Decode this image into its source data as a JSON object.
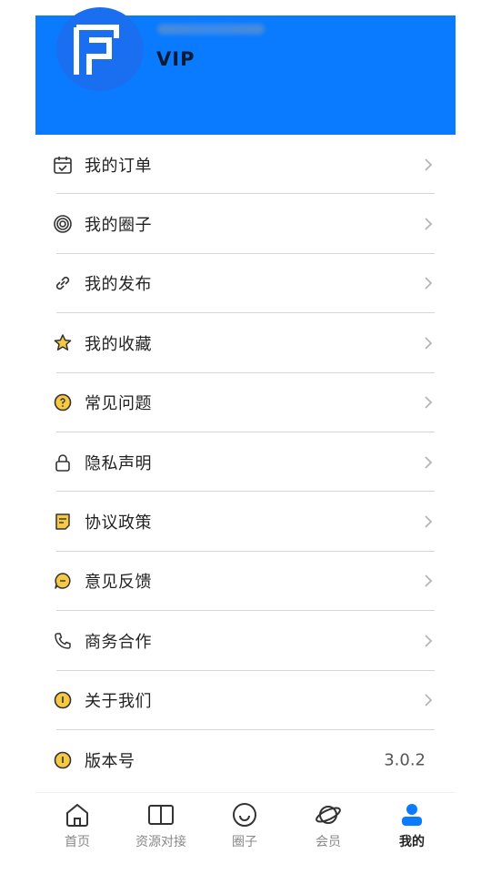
{
  "header": {
    "username": "████████",
    "badge": "VIP",
    "color": "#0a7bff"
  },
  "menu": [
    {
      "label": "我的订单",
      "icon": "calendar-check-icon"
    },
    {
      "label": "我的圈子",
      "icon": "target-circle-icon"
    },
    {
      "label": "我的发布",
      "icon": "link-icon"
    },
    {
      "label": "我的收藏",
      "icon": "star-icon"
    },
    {
      "label": "常见问题",
      "icon": "question-circle-icon"
    },
    {
      "label": "隐私声明",
      "icon": "lock-icon"
    },
    {
      "label": "协议政策",
      "icon": "document-icon"
    },
    {
      "label": "意见反馈",
      "icon": "chat-bubble-icon"
    },
    {
      "label": "商务合作",
      "icon": "phone-icon"
    },
    {
      "label": "关于我们",
      "icon": "info-circle-icon"
    },
    {
      "label": "版本号",
      "icon": "info-circle-icon",
      "value": "3.0.2"
    }
  ],
  "tabbar": {
    "items": [
      {
        "label": "首页",
        "icon": "home-icon"
      },
      {
        "label": "资源对接",
        "icon": "book-icon"
      },
      {
        "label": "圈子",
        "icon": "smile-icon"
      },
      {
        "label": "会员",
        "icon": "planet-icon"
      },
      {
        "label": "我的",
        "icon": "user-icon",
        "active": true
      }
    ],
    "active_color": "#0a7bff"
  }
}
